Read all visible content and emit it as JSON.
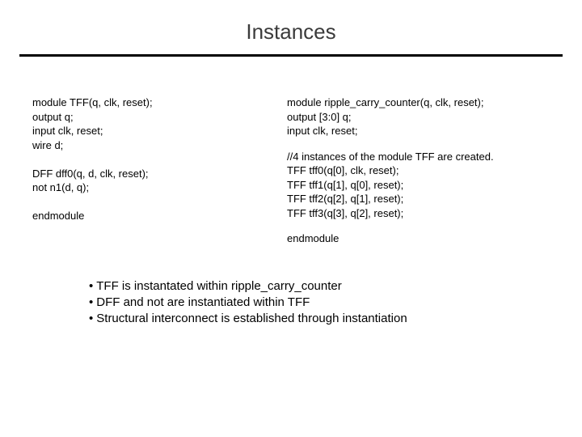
{
  "title": "Instances",
  "left_block": "module TFF(q, clk, reset);\noutput q;\ninput clk, reset;\nwire d;\n\nDFF dff0(q, d, clk, reset);\nnot n1(d, q);\n\nendmodule",
  "right_block_top": "module ripple_carry_counter(q, clk, reset);\noutput [3:0] q;\ninput clk, reset;",
  "right_block_mid": "//4 instances of the module TFF are created.\nTFF tff0(q[0], clk, reset);\nTFF tff1(q[1], q[0], reset);\nTFF tff2(q[2], q[1], reset);\nTFF tff3(q[3], q[2], reset);",
  "right_block_end": "endmodule",
  "bullets": {
    "b1": "TFF is instantated within ripple_carry_counter",
    "b2": "DFF and not are instantiated within TFF",
    "b3": "Structural interconnect is established through instantiation"
  }
}
